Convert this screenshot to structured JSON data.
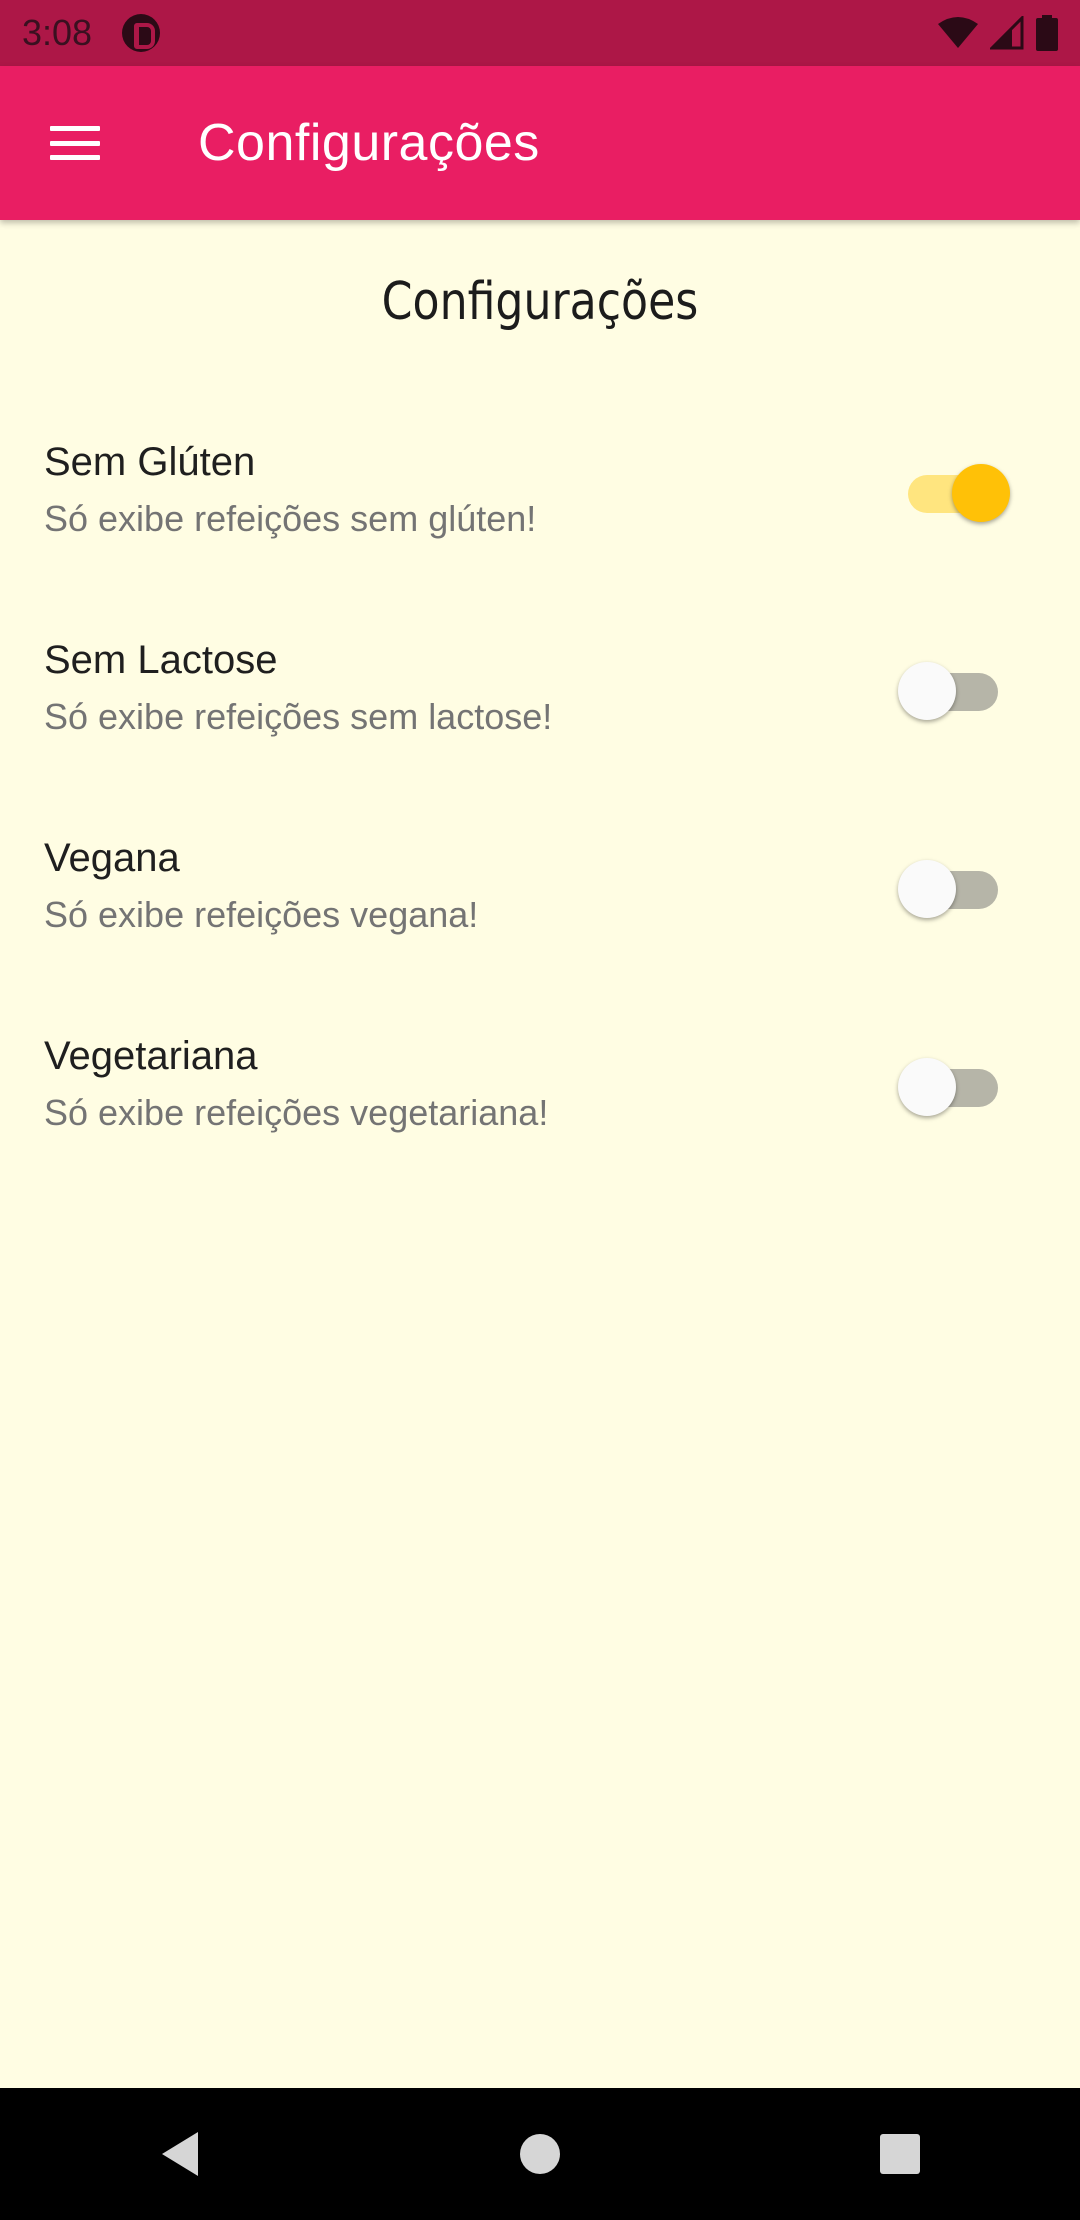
{
  "status_bar": {
    "time": "3:08"
  },
  "app_bar": {
    "title": "Configurações"
  },
  "page": {
    "heading": "Configurações"
  },
  "settings": [
    {
      "title": "Sem Glúten",
      "subtitle": "Só exibe refeições sem glúten!",
      "enabled": true
    },
    {
      "title": "Sem Lactose",
      "subtitle": "Só exibe refeições sem lactose!",
      "enabled": false
    },
    {
      "title": "Vegana",
      "subtitle": "Só exibe refeições vegana!",
      "enabled": false
    },
    {
      "title": "Vegetariana",
      "subtitle": "Só exibe refeições vegetariana!",
      "enabled": false
    }
  ],
  "colors": {
    "app_bar": "#E91E63",
    "status_bar": "#AD1747",
    "background": "#FFFDE3",
    "switch_on_thumb": "#FFC107",
    "switch_on_track": "#FFE57F"
  },
  "icons": {
    "menu": "hamburger-menu-icon",
    "wifi": "wifi-icon",
    "signal": "cell-signal-icon",
    "battery": "battery-icon",
    "back": "back-triangle-icon",
    "home": "home-circle-icon",
    "recents": "recents-square-icon"
  }
}
